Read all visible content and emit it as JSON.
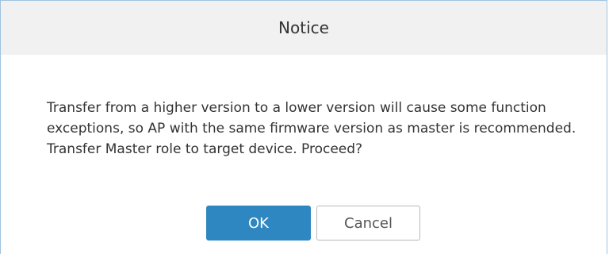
{
  "dialog": {
    "title": "Notice",
    "message": "Transfer from a higher version to a lower version will cause some function exceptions, so AP with the same firmware version as master is recommended. Transfer Master role to target device. Proceed?",
    "ok_label": "OK",
    "cancel_label": "Cancel"
  },
  "colors": {
    "header_bg": "#f1f1f1",
    "primary_button": "#2e87c1",
    "border": "#9ec3e0"
  }
}
